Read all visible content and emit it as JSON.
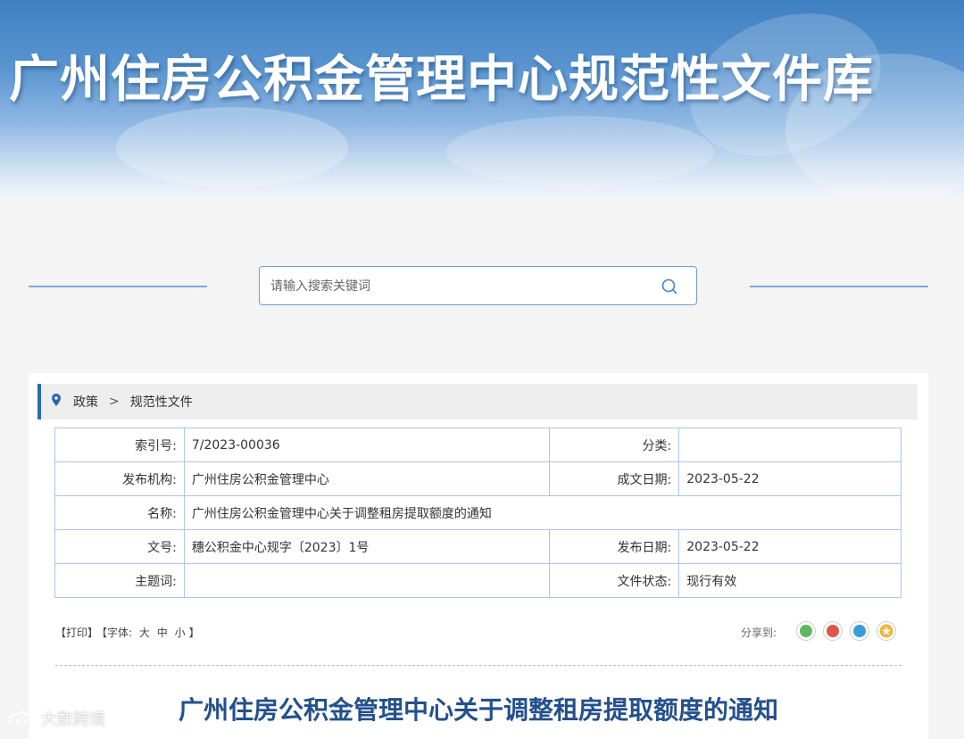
{
  "header": {
    "title": "广州住房公积金管理中心规范性文件库"
  },
  "search": {
    "placeholder": "请输入搜索关键词",
    "icon": "search-icon"
  },
  "breadcrumb": {
    "icon": "location-pin-icon",
    "items": [
      "政策",
      "规范性文件"
    ],
    "separator": ">"
  },
  "meta": {
    "index_label": "索引号:",
    "index_value": "7/2023-00036",
    "category_label": "分类:",
    "category_value": "",
    "publisher_label": "发布机构:",
    "publisher_value": "广州住房公积金管理中心",
    "created_label": "成文日期:",
    "created_value": "2023-05-22",
    "name_label": "名称:",
    "name_value": "广州住房公积金管理中心关于调整租房提取额度的通知",
    "docno_label": "文号:",
    "docno_value": "穗公积金中心规字〔2023〕1号",
    "pubdate_label": "发布日期:",
    "pubdate_value": "2023-05-22",
    "subject_label": "主题词:",
    "subject_value": "",
    "status_label": "文件状态:",
    "status_value": "现行有效"
  },
  "toolbar": {
    "print": "【打印】",
    "font_open": "【字体:",
    "font_large": "大",
    "font_medium": "中",
    "font_small": "小",
    "font_close": "】"
  },
  "share": {
    "label": "分享到:",
    "targets": [
      {
        "name": "wechat",
        "color": "#5cb85c"
      },
      {
        "name": "weibo",
        "color": "#e2534a"
      },
      {
        "name": "qq",
        "color": "#3a9bd9"
      },
      {
        "name": "qzone",
        "color": "#f0b63a"
      }
    ]
  },
  "document": {
    "title": "广州住房公积金管理中心关于调整租房提取额度的通知"
  },
  "watermark": {
    "text": "大数跨境"
  },
  "colors": {
    "accent": "#2f69ad",
    "title": "#24508c",
    "border": "#a9c6e6"
  }
}
